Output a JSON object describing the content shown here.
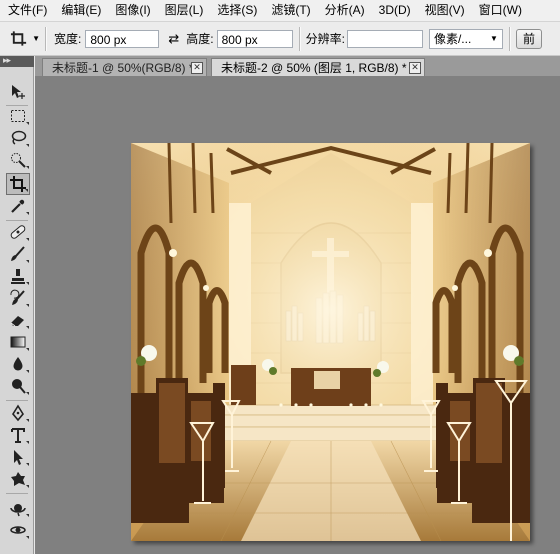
{
  "menu": [
    "文件(F)",
    "编辑(E)",
    "图像(I)",
    "图层(L)",
    "选择(S)",
    "滤镜(T)",
    "分析(A)",
    "3D(D)",
    "视图(V)",
    "窗口(W)"
  ],
  "options": {
    "width_label": "宽度:",
    "width_value": "800 px",
    "swap_icon": "swap-arrows-icon",
    "height_label": "高度:",
    "height_value": "800 px",
    "resolution_label": "分辨率:",
    "resolution_value": "",
    "unit_select": "像素/...",
    "front_button": "前"
  },
  "tabs": [
    {
      "label": "未标题-1 @ 50%(RGB/8) *",
      "active": false
    },
    {
      "label": "未标题-2 @ 50% (图层 1, RGB/8) *",
      "active": true
    }
  ],
  "tools": [
    "move-tool-icon",
    "marquee-tool-icon",
    "lasso-tool-icon",
    "quick-select-tool-icon",
    "crop-tool-icon",
    "eyedropper-tool-icon",
    "healing-brush-tool-icon",
    "brush-tool-icon",
    "clone-stamp-tool-icon",
    "history-brush-tool-icon",
    "eraser-tool-icon",
    "gradient-tool-icon",
    "blur-tool-icon",
    "dodge-tool-icon",
    "pen-tool-icon",
    "type-tool-icon",
    "path-select-tool-icon",
    "shape-tool-icon",
    "3d-rotate-tool-icon",
    "3d-orbit-tool-icon"
  ],
  "colors": {
    "workspace": "#808080",
    "panel": "#d6d6d6",
    "active_tab": "#d9d9d9"
  }
}
